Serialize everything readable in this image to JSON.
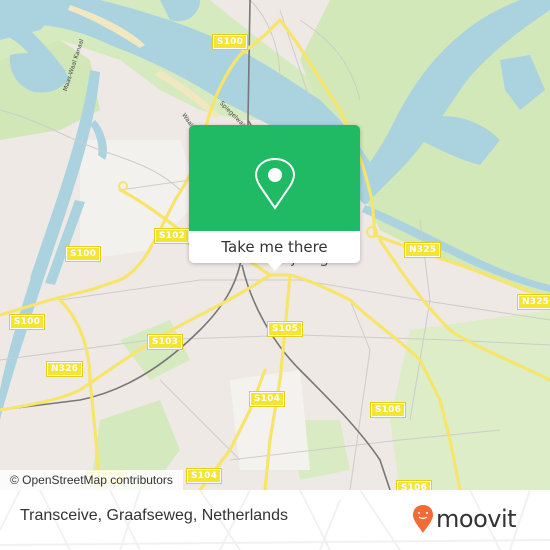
{
  "map": {
    "city_label": "Nijmegen",
    "water_labels": [
      "Maas-Waal Kanaal",
      "Waal",
      "Spiegelwaal"
    ],
    "road_shields": [
      {
        "label": "S100",
        "id": "s100-north"
      },
      {
        "label": "S100",
        "id": "s100-west"
      },
      {
        "label": "S100",
        "id": "s100-southwest"
      },
      {
        "label": "S102",
        "id": "s102"
      },
      {
        "label": "S103",
        "id": "s103"
      },
      {
        "label": "N326",
        "id": "n326"
      },
      {
        "label": "S105",
        "id": "s105"
      },
      {
        "label": "S104",
        "id": "s104"
      },
      {
        "label": "S106",
        "id": "s106"
      },
      {
        "label": "N325",
        "id": "n325-center"
      },
      {
        "label": "N325",
        "id": "n325-east"
      },
      {
        "label": "S100",
        "id": "s100-bottom"
      },
      {
        "label": "S104",
        "id": "s104-bottom"
      },
      {
        "label": "S106",
        "id": "s106-bottom"
      }
    ],
    "attribution": "© OpenStreetMap contributors",
    "colors": {
      "water": "#aad3df",
      "land": "#efe9e6",
      "green": "#cde6b2",
      "road": "#f7e46b",
      "shield": "#f5e431"
    }
  },
  "popup": {
    "icon": "map-pin-icon",
    "button_label": "Take me there",
    "accent_color": "#1fba63"
  },
  "footer": {
    "address": "Transceive, Graafseweg, Netherlands",
    "brand": "moovit",
    "brand_color": "#f26a36"
  }
}
